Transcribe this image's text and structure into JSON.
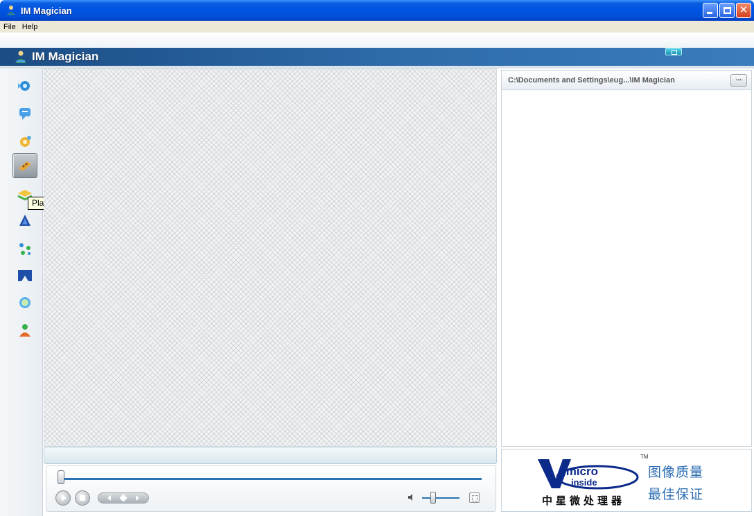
{
  "window": {
    "title": "IM Magician",
    "controls": [
      "minimize",
      "maximize",
      "close"
    ]
  },
  "menu": {
    "items": [
      "File",
      "Help"
    ]
  },
  "header": {
    "brand": "IM Magician"
  },
  "toolbar": {
    "tools": [
      {
        "icon": "webcam-icon"
      },
      {
        "icon": "chat-icon"
      },
      {
        "icon": "effects-icon"
      },
      {
        "icon": "play-icon",
        "active": true
      },
      {
        "icon": "layers-icon"
      },
      {
        "icon": "paint-icon"
      },
      {
        "icon": "connect-icon"
      },
      {
        "icon": "frame-icon"
      },
      {
        "icon": "lens-icon"
      },
      {
        "icon": "user-icon"
      }
    ],
    "tooltip": "Play"
  },
  "player": {
    "seek_position": 0,
    "volume_level": 0.25
  },
  "file_panel": {
    "path": "C:\\Documents and Settings\\eug...\\IM Magician",
    "browse_label": "..."
  },
  "badge": {
    "brand_word": "imicro",
    "inside_word": "inside",
    "tm": "TM",
    "slogan_line1": "图像质量",
    "slogan_line2": "最佳保证",
    "company_cn": "中星微处理器"
  },
  "colors": {
    "titlebar": "#0054e3",
    "header_band": "#2d6aa8",
    "seek_track": "#2a73b4",
    "badge_text": "#2d6eb3"
  }
}
